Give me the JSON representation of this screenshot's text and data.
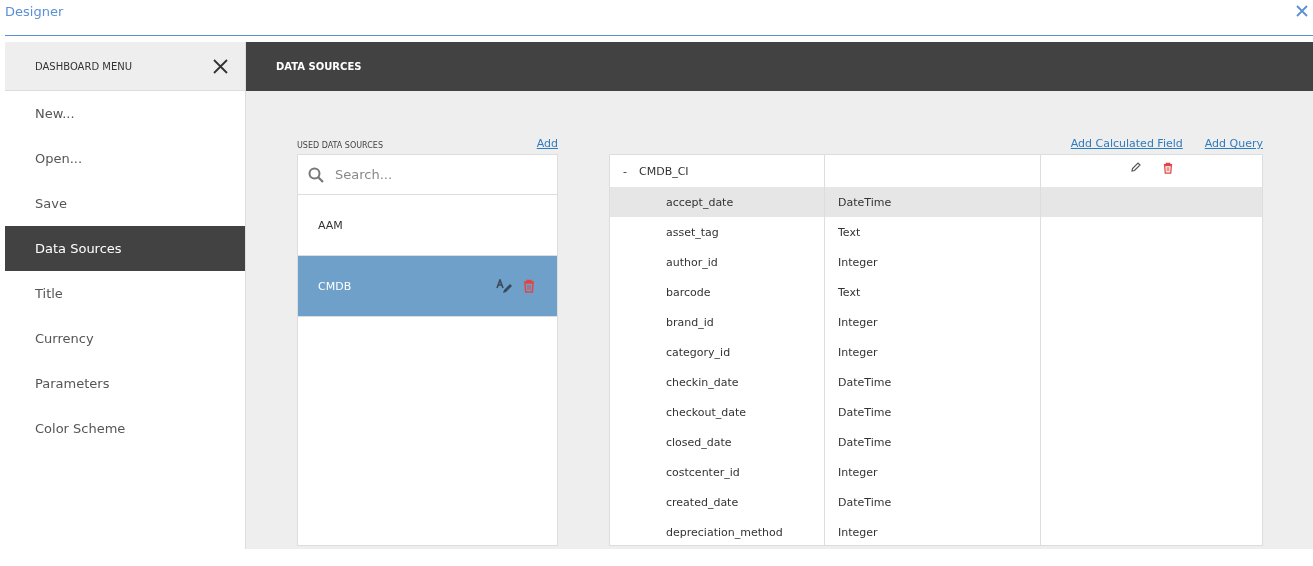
{
  "window": {
    "title": "Designer"
  },
  "sidebar": {
    "title": "DASHBOARD MENU",
    "items": [
      {
        "label": "New...",
        "selected": false
      },
      {
        "label": "Open...",
        "selected": false
      },
      {
        "label": "Save",
        "selected": false
      },
      {
        "label": "Data Sources",
        "selected": true
      },
      {
        "label": "Title",
        "selected": false
      },
      {
        "label": "Currency",
        "selected": false
      },
      {
        "label": "Parameters",
        "selected": false
      },
      {
        "label": "Color Scheme",
        "selected": false
      }
    ]
  },
  "main": {
    "title": "DATA SOURCES"
  },
  "sources": {
    "label": "USED DATA SOURCES",
    "add_link": "Add",
    "search": {
      "placeholder": "Search..."
    },
    "items": [
      {
        "name": "AAM",
        "selected": false
      },
      {
        "name": "CMDB",
        "selected": true
      }
    ]
  },
  "links": [
    "Add Calculated Field",
    "Add Query"
  ],
  "query": {
    "expand": "-",
    "name": "CMDB_CI",
    "expanded": true,
    "fields": [
      {
        "name": "accept_date",
        "type": "DateTime",
        "selected": true
      },
      {
        "name": "asset_tag",
        "type": "Text",
        "selected": false
      },
      {
        "name": "author_id",
        "type": "Integer",
        "selected": false
      },
      {
        "name": "barcode",
        "type": "Text",
        "selected": false
      },
      {
        "name": "brand_id",
        "type": "Integer",
        "selected": false
      },
      {
        "name": "category_id",
        "type": "Integer",
        "selected": false
      },
      {
        "name": "checkin_date",
        "type": "DateTime",
        "selected": false
      },
      {
        "name": "checkout_date",
        "type": "DateTime",
        "selected": false
      },
      {
        "name": "closed_date",
        "type": "DateTime",
        "selected": false
      },
      {
        "name": "costcenter_id",
        "type": "Integer",
        "selected": false
      },
      {
        "name": "created_date",
        "type": "DateTime",
        "selected": false
      },
      {
        "name": "depreciation_method",
        "type": "Integer",
        "selected": false
      }
    ]
  }
}
